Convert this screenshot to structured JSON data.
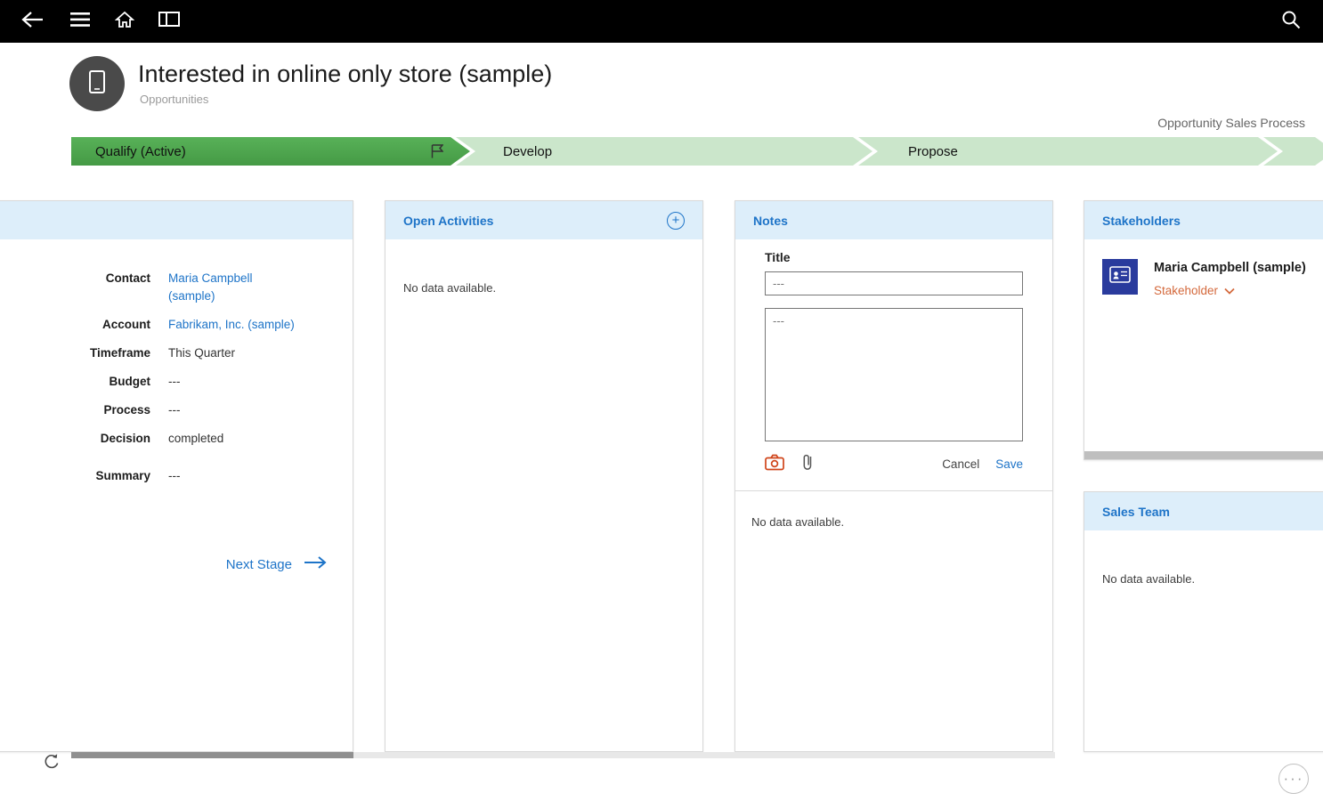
{
  "header": {
    "title": "Interested in online only store (sample)",
    "subtitle": "Opportunities",
    "process_name": "Opportunity Sales Process"
  },
  "process": {
    "stages": [
      {
        "label": "Qualify (Active)",
        "state": "active"
      },
      {
        "label": "Develop",
        "state": "inactive"
      },
      {
        "label": "Propose",
        "state": "inactive"
      }
    ]
  },
  "details_card": {
    "fields": [
      {
        "label": "Contact",
        "value": "Maria Campbell (sample)"
      },
      {
        "label": "Account",
        "value": "Fabrikam, Inc. (sample)"
      },
      {
        "label": "Timeframe",
        "value": "This Quarter"
      },
      {
        "label": "Budget",
        "value": "---"
      },
      {
        "label": "Process",
        "value": "---"
      },
      {
        "label": "Decision",
        "value": "completed"
      },
      {
        "label": "Summary",
        "value": "---"
      }
    ],
    "next_stage_label": "Next Stage"
  },
  "open_activities": {
    "title": "Open Activities",
    "empty_text": "No data available."
  },
  "notes": {
    "title": "Notes",
    "title_field_label": "Title",
    "title_value": "---",
    "body_value": "---",
    "cancel_label": "Cancel",
    "save_label": "Save",
    "empty_text": "No data available."
  },
  "stakeholders": {
    "title": "Stakeholders",
    "member_name": "Maria Campbell (sample)",
    "member_role": "Stakeholder"
  },
  "sales_team": {
    "title": "Sales Team",
    "empty_text": "No data available."
  },
  "colors": {
    "accent_blue": "#1e74c8",
    "active_stage_green": "#4da64d",
    "inactive_stage_green": "#cbe6cb",
    "card_header_bg": "#ddeefa",
    "role_orange": "#d4693c",
    "camera_red": "#d0451b",
    "topbar_black": "#000000"
  }
}
